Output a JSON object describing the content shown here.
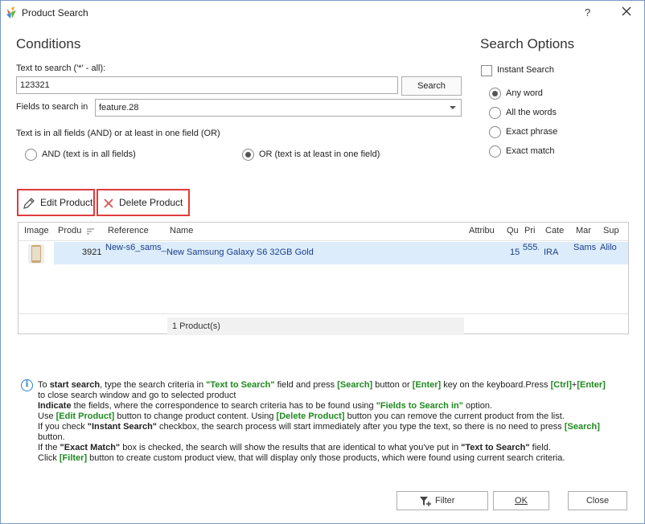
{
  "window": {
    "title": "Product Search",
    "help": "?"
  },
  "conditions": {
    "heading": "Conditions",
    "text_label": "Text to search ('*' - all):",
    "text_value": "123321",
    "search_button": "Search",
    "fields_label": "Fields to search in",
    "fields_value": "feature.28",
    "logic_label": "Text is in all fields (AND) or at least in one field (OR)",
    "and_option": "AND (text is in all fields)",
    "or_option": "OR (text is at least in one field)",
    "selected_logic": "OR"
  },
  "search_options": {
    "heading": "Search Options",
    "instant_search": "Instant Search",
    "instant_checked": false,
    "options": [
      "Any word",
      "All the words",
      "Exact phrase",
      "Exact match"
    ],
    "selected": "Any word"
  },
  "toolbar": {
    "edit_label": "Edit Product",
    "delete_label": "Delete Product"
  },
  "grid": {
    "columns": [
      "Image",
      "Produ",
      "Reference",
      "Name",
      "Attribu",
      "Qu",
      "Pri",
      "Cate",
      "Mar",
      "Sup"
    ],
    "row": {
      "product_id": "3921",
      "reference": "New-s6_sams_",
      "name": "New Samsung Galaxy S6 32GB Gold",
      "quantity": "15",
      "price": "555.",
      "category": "IRA",
      "manufacturer": "Sams",
      "supplier": "Alilo"
    },
    "footer": "1 Product(s)"
  },
  "info": {
    "l1a": "To ",
    "l1b": "start search",
    "l1c": ", type the search criteria in ",
    "l1d": "\"Text to Search\"",
    "l1e": " field and press ",
    "l1f": "[Search]",
    "l1g": " button or ",
    "l1h": "[Enter]",
    "l1i": " key on the keyboard.Press ",
    "l1j": "[Ctrl]",
    "l1k": "+",
    "l1l": "[Enter]",
    "l2": "to close search window and go to selected product",
    "l3a": "Indicate",
    "l3b": " the fields, where the correspondence to search criteria has to be found using ",
    "l3c": "\"Fields to Search in\"",
    "l3d": " option.",
    "l4a": "Use ",
    "l4b": "[Edit Product]",
    "l4c": " button to change product content. Using ",
    "l4d": "[Delete Product]",
    "l4e": " button you can remove the current product from the list.",
    "l5a": "If you check ",
    "l5b": "\"Instant Search\"",
    "l5c": " checkbox, the search process will start immediately after you type the text, so there is no need to press ",
    "l5d": "[Search]",
    "l6": "button.",
    "l7a": "If the ",
    "l7b": "\"Exact Match\"",
    "l7c": " box is checked, the search will show the results that are identical to what you've put in ",
    "l7d": "\"Text to Search\"",
    "l7e": " field.",
    "l8a": "Click ",
    "l8b": "[Filter]",
    "l8c": " button to create custom product view, that will display only those products, which were found using current search criteria."
  },
  "footer_buttons": {
    "filter": "Filter",
    "ok": "OK",
    "close": "Close"
  },
  "colors": {
    "highlight_border": "#e03c3c",
    "selected_row": "#dcecfb",
    "accent_green": "#1e8a1e",
    "info_blue": "#2a7fd4"
  }
}
